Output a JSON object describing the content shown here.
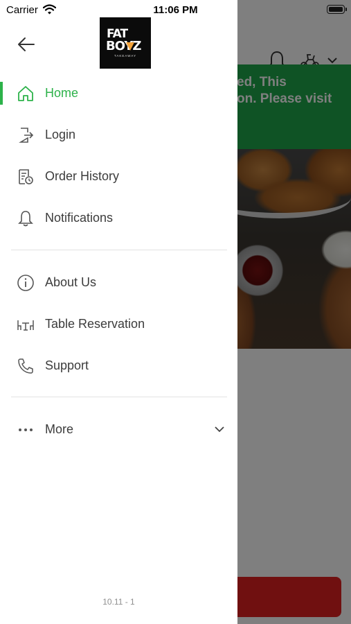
{
  "status_bar": {
    "carrier": "Carrier",
    "time": "11:06 PM"
  },
  "brand": {
    "logo_line1": "FAT",
    "logo_line2": "BOYZ",
    "logo_tagline": "TAKEAWAY"
  },
  "menu": {
    "items": [
      {
        "label": "Home",
        "icon": "home-icon",
        "active": true
      },
      {
        "label": "Login",
        "icon": "login-icon",
        "active": false
      },
      {
        "label": "Order History",
        "icon": "order-history-icon",
        "active": false
      },
      {
        "label": "Notifications",
        "icon": "bell-icon",
        "active": false
      },
      {
        "label": "About Us",
        "icon": "info-icon",
        "active": false
      },
      {
        "label": "Table Reservation",
        "icon": "table-icon",
        "active": false
      },
      {
        "label": "Support",
        "icon": "phone-icon",
        "active": false
      },
      {
        "label": "More",
        "icon": "more-icon",
        "active": false
      }
    ]
  },
  "background": {
    "banner_text_line1": "ed, This",
    "banner_text_line2": "on. Please visit"
  },
  "footer": {
    "version": "10.11 - 1"
  },
  "colors": {
    "accent": "#2db24a",
    "banner": "#1fa64a",
    "cta": "#e02020",
    "overlay": "rgba(0,0,0,0.5)"
  }
}
